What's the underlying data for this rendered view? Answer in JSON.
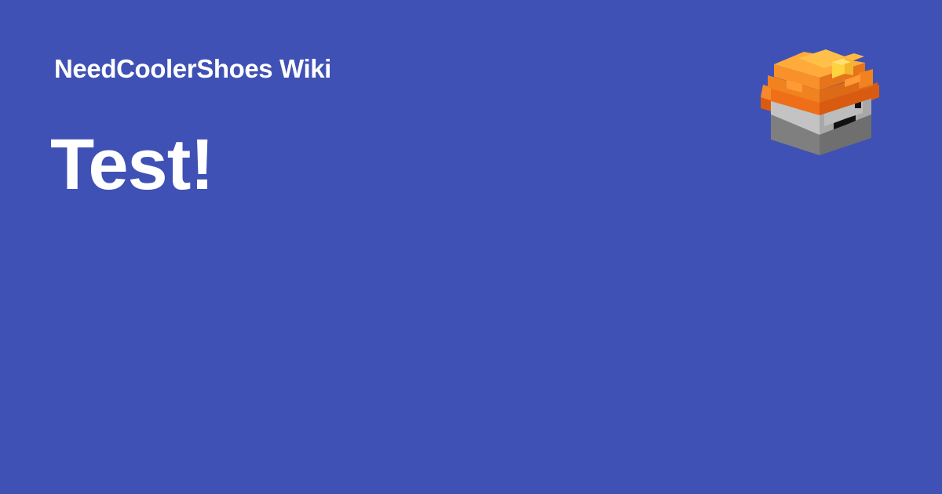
{
  "site": {
    "name": "NeedCoolerShoes Wiki"
  },
  "page": {
    "title": "Test!"
  },
  "logo": {
    "icon": "voxel-miner-head-icon"
  },
  "colors": {
    "background": "#3f51b5",
    "text": "#ffffff",
    "helmet": "#f47c20",
    "helmet_light": "#ffa53a",
    "lamp": "#ffd23f",
    "face": "#b9b9b9",
    "face_shadow": "#7a7a7a",
    "eyes_mouth": "#111111"
  }
}
